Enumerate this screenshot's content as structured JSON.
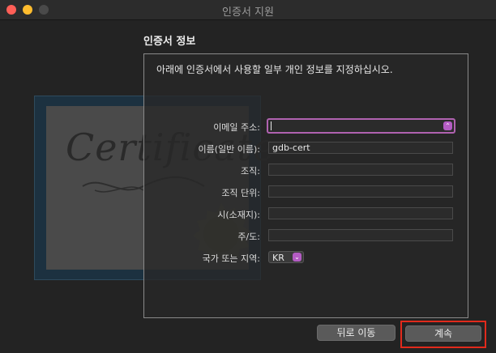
{
  "window": {
    "title": "인증서 지원"
  },
  "certificate_art": {
    "script_text": "Certificate"
  },
  "section": {
    "title": "인증서 정보"
  },
  "panel": {
    "instruction": "아래에 인증서에서 사용할 일부 개인 정보를 지정하십시오."
  },
  "form": {
    "email": {
      "label": "이메일 주소:",
      "value": ""
    },
    "common_name": {
      "label": "이름(일반 이름):",
      "value": "gdb-cert"
    },
    "organization": {
      "label": "조직:",
      "value": ""
    },
    "org_unit": {
      "label": "조직 단위:",
      "value": ""
    },
    "city": {
      "label": "시(소재지):",
      "value": ""
    },
    "state": {
      "label": "주/도:",
      "value": ""
    },
    "country": {
      "label": "국가 또는 지역:",
      "value": "KR"
    }
  },
  "buttons": {
    "back": "뒤로 이동",
    "continue": "계속"
  },
  "colors": {
    "accent": "#b45cc4",
    "focus_ring": "#b062b0",
    "highlight": "#e12a1c"
  },
  "icons": {
    "dropdown": "chevron-updown-icon"
  }
}
